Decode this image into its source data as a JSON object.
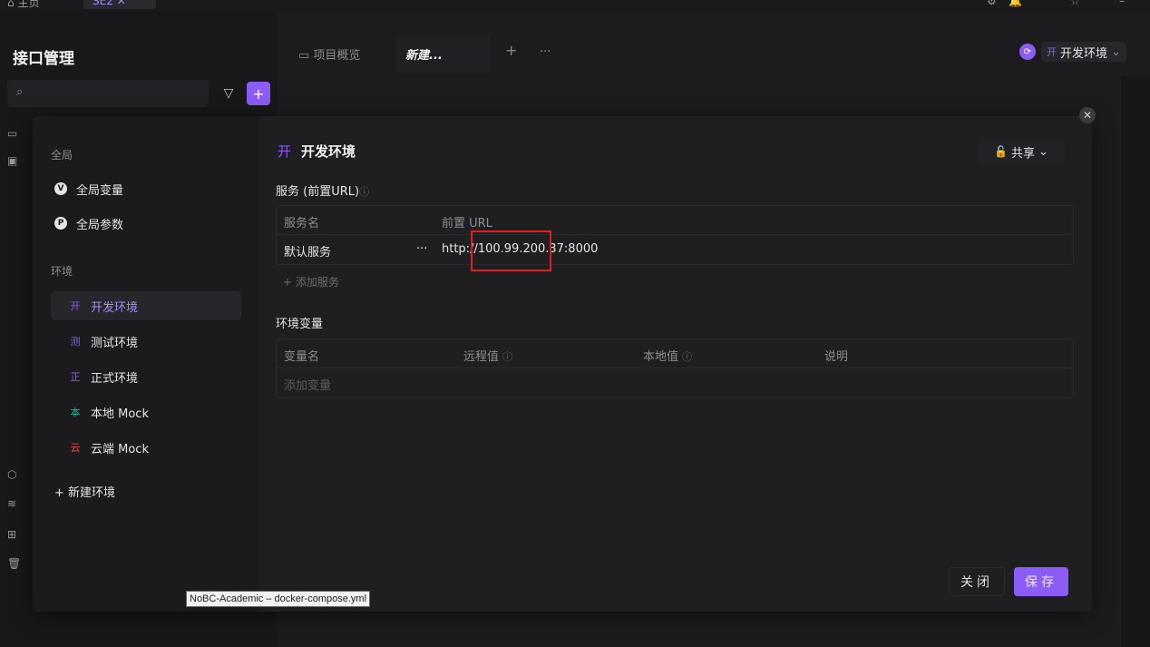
{
  "chrome": {
    "home_tab": "主页",
    "active_tab": "SE2"
  },
  "app": {
    "title": "接口管理"
  },
  "doc_tabs": [
    {
      "label": "项目概览"
    },
    {
      "label": "新建..."
    }
  ],
  "env_switch": {
    "badge": "开",
    "label": "开发环境"
  },
  "search": {
    "placeholder": ""
  },
  "modal": {
    "left": {
      "global_title": "全局",
      "global_items": [
        {
          "icon": "V",
          "label": "全局变量"
        },
        {
          "icon": "P",
          "label": "全局参数"
        }
      ],
      "env_title": "环境",
      "envs": [
        {
          "badge": "开",
          "label": "开发环境",
          "color": "#8b5cf6"
        },
        {
          "badge": "测",
          "label": "测试环境",
          "color": "#8b5cf6"
        },
        {
          "badge": "正",
          "label": "正式环境",
          "color": "#8b5cf6"
        },
        {
          "badge": "本",
          "label": "本地 Mock",
          "color": "#14b8a6"
        },
        {
          "badge": "云",
          "label": "云端 Mock",
          "color": "#ef4444"
        }
      ],
      "new_env": "+ 新建环境"
    },
    "editor": {
      "env_badge": "开",
      "env_name": "开发环境",
      "share_label": "共享",
      "service_title": "服务 (前置URL)",
      "service_headers": [
        "服务名",
        "前置 URL"
      ],
      "services": [
        {
          "name": "默认服务",
          "more": "···",
          "url": "http://100.99.200.37:8000"
        }
      ],
      "add_service": "+ 添加服务",
      "vars_title": "环境变量",
      "vars_headers": [
        "变量名",
        "远程值",
        "本地值",
        "说明"
      ],
      "add_var": "添加变量"
    },
    "buttons": {
      "close": "关闭",
      "save": "保存"
    }
  },
  "tooltip": "NoBC-Academic – docker-compose.yml"
}
